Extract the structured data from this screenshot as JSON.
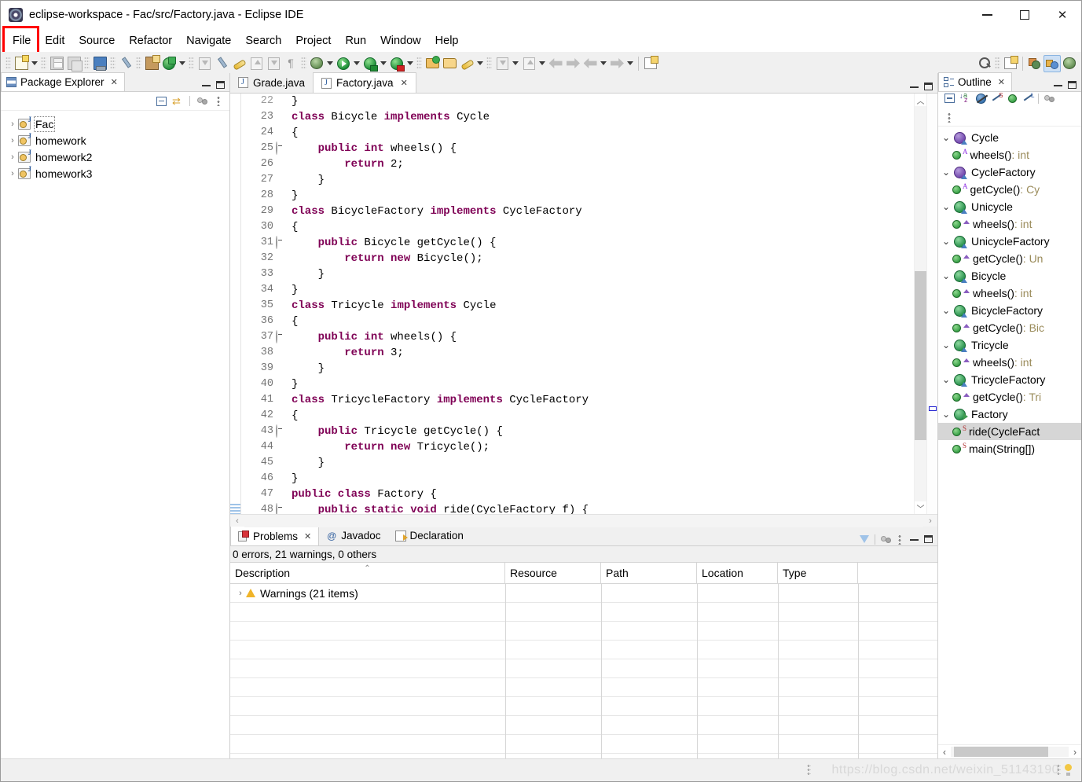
{
  "window": {
    "title": "eclipse-workspace - Fac/src/Factory.java - Eclipse IDE",
    "app_icon": "eclipse-icon",
    "minimize_label": "",
    "maximize_label": "",
    "close_label": "✕"
  },
  "menubar": {
    "items": [
      {
        "label": "File",
        "highlighted": true
      },
      {
        "label": "Edit"
      },
      {
        "label": "Source"
      },
      {
        "label": "Refactor"
      },
      {
        "label": "Navigate"
      },
      {
        "label": "Search"
      },
      {
        "label": "Project"
      },
      {
        "label": "Run"
      },
      {
        "label": "Window"
      },
      {
        "label": "Help"
      }
    ],
    "highlight_color": "#ff0000"
  },
  "toolbar": {
    "left_icons": [
      "new-wizard-icon",
      "save-icon",
      "save-all-icon",
      "print-icon",
      "toggle-mark-occurrences-icon",
      "new-java-package-icon",
      "new-java-class-icon",
      "open-type-icon",
      "ruler-icon",
      "link-icon",
      "external-tools-icon",
      "toggle-block-selection-icon",
      "show-whitespace-icon",
      "debug-icon",
      "run-icon",
      "run-configurations-icon",
      "coverage-icon",
      "open-perspective-icon",
      "open-folder-icon",
      "rocket-icon",
      "import-icon",
      "export-icon",
      "back-icon",
      "forward-icon",
      "previous-annotation-icon",
      "next-annotation-icon",
      "new-window-icon"
    ],
    "right_icons": [
      "search-icon",
      "new-table-icon",
      "perspective-package-icon",
      "perspective-java-icon",
      "perspective-debug-icon"
    ]
  },
  "package_explorer": {
    "tab_label": "Package Explorer",
    "tab_close": "✕",
    "toolbar_icons": [
      "collapse-all-icon",
      "link-with-editor-icon",
      "view-menu-icon",
      "minimize-icon"
    ],
    "projects": [
      {
        "name": "Fac",
        "expanded": false,
        "focused": true
      },
      {
        "name": "homework",
        "expanded": false,
        "focused": false
      },
      {
        "name": "homework2",
        "expanded": false,
        "focused": false
      },
      {
        "name": "homework3",
        "expanded": false,
        "focused": false
      }
    ]
  },
  "editor": {
    "tabs": [
      {
        "label": "Grade.java",
        "active": false,
        "close": ""
      },
      {
        "label": "Factory.java",
        "active": true,
        "close": "✕"
      }
    ],
    "first_visible_line": 22,
    "lines": [
      {
        "n": 22,
        "marker": "",
        "fold": "",
        "partial": true,
        "tokens": [
          {
            "t": "}",
            "c": "pl"
          }
        ]
      },
      {
        "n": 23,
        "marker": "",
        "fold": "",
        "tokens": [
          {
            "t": "class ",
            "c": "kw"
          },
          {
            "t": "Bicycle ",
            "c": "pl"
          },
          {
            "t": "implements ",
            "c": "kw"
          },
          {
            "t": "Cycle",
            "c": "pl"
          }
        ]
      },
      {
        "n": 24,
        "marker": "",
        "fold": "",
        "tokens": [
          {
            "t": "{",
            "c": "pl"
          }
        ]
      },
      {
        "n": 25,
        "marker": "warning",
        "fold": "collapse",
        "tokens": [
          {
            "t": "    ",
            "c": "pl"
          },
          {
            "t": "public int ",
            "c": "kw"
          },
          {
            "t": "wheels() {",
            "c": "pl"
          }
        ]
      },
      {
        "n": 26,
        "marker": "",
        "fold": "",
        "tokens": [
          {
            "t": "        ",
            "c": "pl"
          },
          {
            "t": "return ",
            "c": "kw"
          },
          {
            "t": "2;",
            "c": "pl"
          }
        ]
      },
      {
        "n": 27,
        "marker": "",
        "fold": "",
        "tokens": [
          {
            "t": "    }",
            "c": "pl"
          }
        ]
      },
      {
        "n": 28,
        "marker": "",
        "fold": "",
        "tokens": [
          {
            "t": "}",
            "c": "pl"
          }
        ]
      },
      {
        "n": 29,
        "marker": "",
        "fold": "",
        "tokens": [
          {
            "t": "class ",
            "c": "kw"
          },
          {
            "t": "BicycleFactory ",
            "c": "pl"
          },
          {
            "t": "implements ",
            "c": "kw"
          },
          {
            "t": "CycleFactory",
            "c": "pl"
          }
        ]
      },
      {
        "n": 30,
        "marker": "",
        "fold": "",
        "tokens": [
          {
            "t": "{",
            "c": "pl"
          }
        ]
      },
      {
        "n": 31,
        "marker": "warning",
        "fold": "collapse",
        "tokens": [
          {
            "t": "    ",
            "c": "pl"
          },
          {
            "t": "public ",
            "c": "kw"
          },
          {
            "t": "Bicycle getCycle() {",
            "c": "pl"
          }
        ]
      },
      {
        "n": 32,
        "marker": "",
        "fold": "",
        "tokens": [
          {
            "t": "        ",
            "c": "pl"
          },
          {
            "t": "return new ",
            "c": "kw"
          },
          {
            "t": "Bicycle();",
            "c": "pl"
          }
        ]
      },
      {
        "n": 33,
        "marker": "",
        "fold": "",
        "tokens": [
          {
            "t": "    }",
            "c": "pl"
          }
        ]
      },
      {
        "n": 34,
        "marker": "",
        "fold": "",
        "tokens": [
          {
            "t": "}",
            "c": "pl"
          }
        ]
      },
      {
        "n": 35,
        "marker": "",
        "fold": "",
        "tokens": [
          {
            "t": "class ",
            "c": "kw"
          },
          {
            "t": "Tricycle ",
            "c": "pl"
          },
          {
            "t": "implements ",
            "c": "kw"
          },
          {
            "t": "Cycle",
            "c": "pl"
          }
        ]
      },
      {
        "n": 36,
        "marker": "",
        "fold": "",
        "tokens": [
          {
            "t": "{",
            "c": "pl"
          }
        ]
      },
      {
        "n": 37,
        "marker": "warning",
        "fold": "collapse",
        "tokens": [
          {
            "t": "    ",
            "c": "pl"
          },
          {
            "t": "public int ",
            "c": "kw"
          },
          {
            "t": "wheels() {",
            "c": "pl"
          }
        ]
      },
      {
        "n": 38,
        "marker": "",
        "fold": "",
        "tokens": [
          {
            "t": "        ",
            "c": "pl"
          },
          {
            "t": "return ",
            "c": "kw"
          },
          {
            "t": "3;",
            "c": "pl"
          }
        ]
      },
      {
        "n": 39,
        "marker": "",
        "fold": "",
        "tokens": [
          {
            "t": "    }",
            "c": "pl"
          }
        ]
      },
      {
        "n": 40,
        "marker": "",
        "fold": "",
        "tokens": [
          {
            "t": "}",
            "c": "pl"
          }
        ]
      },
      {
        "n": 41,
        "marker": "",
        "fold": "",
        "tokens": [
          {
            "t": "class ",
            "c": "kw"
          },
          {
            "t": "TricycleFactory ",
            "c": "pl"
          },
          {
            "t": "implements ",
            "c": "kw"
          },
          {
            "t": "CycleFactory",
            "c": "pl"
          }
        ]
      },
      {
        "n": 42,
        "marker": "",
        "fold": "",
        "tokens": [
          {
            "t": "{",
            "c": "pl"
          }
        ]
      },
      {
        "n": 43,
        "marker": "warning",
        "fold": "collapse",
        "tokens": [
          {
            "t": "    ",
            "c": "pl"
          },
          {
            "t": "public ",
            "c": "kw"
          },
          {
            "t": "Tricycle getCycle() {",
            "c": "pl"
          }
        ]
      },
      {
        "n": 44,
        "marker": "breakpoint",
        "fold": "",
        "tokens": [
          {
            "t": "        ",
            "c": "pl"
          },
          {
            "t": "return new ",
            "c": "kw"
          },
          {
            "t": "Tricycle();",
            "c": "pl"
          }
        ]
      },
      {
        "n": 45,
        "marker": "",
        "fold": "",
        "tokens": [
          {
            "t": "    }",
            "c": "pl"
          }
        ]
      },
      {
        "n": 46,
        "marker": "",
        "fold": "",
        "tokens": [
          {
            "t": "}",
            "c": "pl"
          }
        ]
      },
      {
        "n": 47,
        "marker": "",
        "fold": "",
        "tokens": [
          {
            "t": "public class ",
            "c": "kw"
          },
          {
            "t": "Factory {",
            "c": "pl"
          }
        ]
      },
      {
        "n": 48,
        "marker": "current",
        "fold": "collapse",
        "tokens": [
          {
            "t": "    ",
            "c": "pl"
          },
          {
            "t": "public static void ",
            "c": "kw"
          },
          {
            "t": "ride(CycleFactory f) {",
            "c": "pl"
          }
        ]
      }
    ]
  },
  "problems": {
    "tabs": [
      {
        "label": "Problems",
        "icon": "problems-icon",
        "active": true,
        "close": "✕"
      },
      {
        "label": "Javadoc",
        "icon": "javadoc-icon",
        "active": false,
        "close": ""
      },
      {
        "label": "Declaration",
        "icon": "declaration-icon",
        "active": false,
        "close": ""
      }
    ],
    "toolbar_icons": [
      "filter-icon",
      "view-menu-icon",
      "minimize-icon",
      "maximize-icon"
    ],
    "summary": "0 errors, 21 warnings, 0 others",
    "columns": [
      "Description",
      "Resource",
      "Path",
      "Location",
      "Type"
    ],
    "sorted_column": "Description",
    "rows": [
      {
        "twisty": "›",
        "icon": "warning-icon",
        "description": "Warnings (21 items)",
        "resource": "",
        "path": "",
        "location": "",
        "type": ""
      }
    ]
  },
  "outline": {
    "tab_label": "Outline",
    "tab_close": "✕",
    "toolbar_icons": [
      "collapse-all-icon",
      "sort-icon",
      "hide-fields-icon",
      "hide-static-icon",
      "hide-nonpublic-icon",
      "hide-local-icon",
      "view-menu-icon",
      "minimize-icon"
    ],
    "items": [
      {
        "level": 0,
        "kind": "interface",
        "twisty": "⌄",
        "name": "Cycle",
        "ret": "",
        "modifier": ""
      },
      {
        "level": 1,
        "kind": "method",
        "twisty": "",
        "name": "wheels()",
        "ret": " : int",
        "modifier": "A"
      },
      {
        "level": 0,
        "kind": "interface",
        "twisty": "⌄",
        "name": "CycleFactory",
        "ret": "",
        "modifier": ""
      },
      {
        "level": 1,
        "kind": "method",
        "twisty": "",
        "name": "getCycle()",
        "ret": " : Cy",
        "modifier": "A"
      },
      {
        "level": 0,
        "kind": "class",
        "twisty": "⌄",
        "name": "Unicycle",
        "ret": "",
        "modifier": ""
      },
      {
        "level": 1,
        "kind": "method",
        "twisty": "",
        "name": "wheels()",
        "ret": " : int",
        "modifier": "tri"
      },
      {
        "level": 0,
        "kind": "class",
        "twisty": "⌄",
        "name": "UnicycleFactory",
        "ret": "",
        "modifier": ""
      },
      {
        "level": 1,
        "kind": "method",
        "twisty": "",
        "name": "getCycle()",
        "ret": " : Un",
        "modifier": "tri"
      },
      {
        "level": 0,
        "kind": "class",
        "twisty": "⌄",
        "name": "Bicycle",
        "ret": "",
        "modifier": ""
      },
      {
        "level": 1,
        "kind": "method",
        "twisty": "",
        "name": "wheels()",
        "ret": " : int",
        "modifier": "tri"
      },
      {
        "level": 0,
        "kind": "class",
        "twisty": "⌄",
        "name": "BicycleFactory",
        "ret": "",
        "modifier": ""
      },
      {
        "level": 1,
        "kind": "method",
        "twisty": "",
        "name": "getCycle()",
        "ret": " : Bic",
        "modifier": "tri"
      },
      {
        "level": 0,
        "kind": "class",
        "twisty": "⌄",
        "name": "Tricycle",
        "ret": "",
        "modifier": ""
      },
      {
        "level": 1,
        "kind": "method",
        "twisty": "",
        "name": "wheels()",
        "ret": " : int",
        "modifier": "tri"
      },
      {
        "level": 0,
        "kind": "class",
        "twisty": "⌄",
        "name": "TricycleFactory",
        "ret": "",
        "modifier": ""
      },
      {
        "level": 1,
        "kind": "method",
        "twisty": "",
        "name": "getCycle()",
        "ret": " : Tri",
        "modifier": "tri"
      },
      {
        "level": 0,
        "kind": "class-pub",
        "twisty": "⌄",
        "name": "Factory",
        "ret": "",
        "modifier": ""
      },
      {
        "level": 1,
        "kind": "method",
        "twisty": "",
        "name": "ride(CycleFact",
        "ret": "",
        "modifier": "S",
        "selected": true
      },
      {
        "level": 1,
        "kind": "method",
        "twisty": "",
        "name": "main(String[])",
        "ret": " ",
        "modifier": "S"
      }
    ]
  },
  "statusbar": {
    "watermark": "https://blog.csdn.net/weixin_51143190",
    "icons": [
      "resize-grip-icon",
      "quick-access-icon",
      "tip-bulb-icon"
    ]
  },
  "colors": {
    "keyword": "#7f0055",
    "line_number": "#757575",
    "highlight_box": "#ff0000",
    "selection": "#d6d6d6",
    "chrome": "#f0f0f0"
  }
}
